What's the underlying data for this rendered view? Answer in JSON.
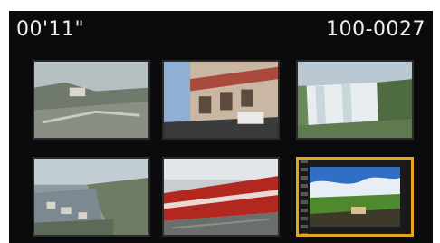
{
  "header": {
    "time_label": "00'11\"",
    "file_number": "100-0027"
  },
  "thumbnails": [
    {
      "name": "thumbnail-1"
    },
    {
      "name": "thumbnail-2"
    },
    {
      "name": "thumbnail-3"
    },
    {
      "name": "thumbnail-4"
    },
    {
      "name": "thumbnail-5"
    },
    {
      "name": "thumbnail-6",
      "selected": true
    }
  ],
  "colors": {
    "screen_bg": "#0b0b0d",
    "selection_border": "#e6a51c",
    "text": "#f0f0f0"
  }
}
